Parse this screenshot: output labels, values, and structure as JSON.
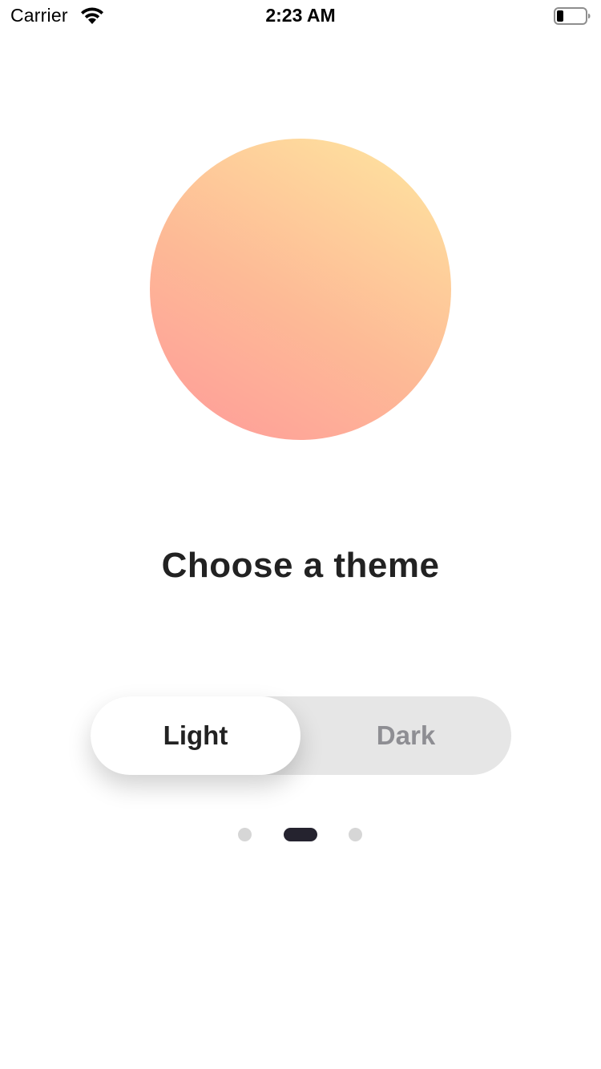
{
  "status_bar": {
    "carrier": "Carrier",
    "time": "2:23 AM",
    "wifi_icon": "wifi-icon",
    "battery_icon": "battery-icon"
  },
  "hero": {
    "gradient_colors": [
      "#ff9a9a",
      "#fdba96",
      "#ffe7a0"
    ]
  },
  "title": "Choose a theme",
  "theme_toggle": {
    "options": [
      {
        "label": "Light",
        "selected": true
      },
      {
        "label": "Dark",
        "selected": false
      }
    ],
    "selected_color": "#ffffff",
    "track_color": "#e6e6e6",
    "unselected_text_color": "#8e8e93"
  },
  "page_indicator": {
    "total": 3,
    "current": 2,
    "active_color": "#25232f",
    "inactive_color": "#d6d6d6"
  }
}
